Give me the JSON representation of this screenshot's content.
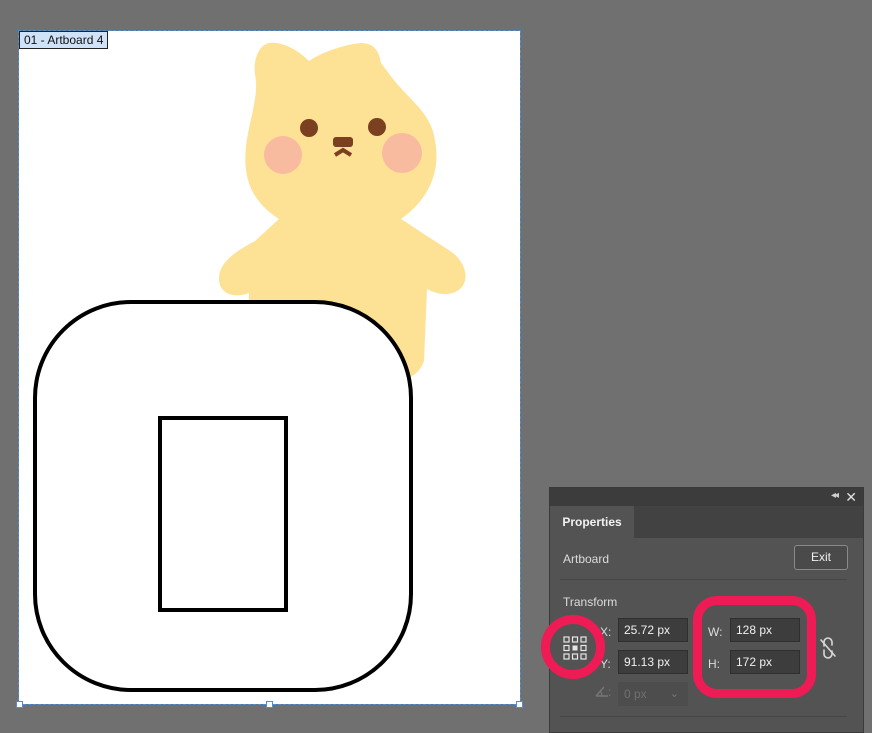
{
  "artboard": {
    "label": "01 - Artboard 4"
  },
  "panel": {
    "tab_label": "Properties",
    "section_label": "Artboard",
    "exit_label": "Exit",
    "transform_label": "Transform",
    "x_label": "X:",
    "x_value": "25.72 px",
    "y_label": "Y:",
    "y_value": "91.13 px",
    "w_label": "W:",
    "w_value": "128 px",
    "h_label": "H:",
    "h_value": "172 px",
    "rotate_value": "0 px",
    "collapse_icon": "double-chevron-left-icon",
    "close_icon": "close-icon",
    "link_icon": "unlink-proportions-icon"
  },
  "colors": {
    "canvas_bg": "#707070",
    "panel_bg": "#535353",
    "highlight": "#ee1b55",
    "character_body": "#fde195",
    "character_cheek": "#f9bba0",
    "character_eye": "#7a4020"
  }
}
